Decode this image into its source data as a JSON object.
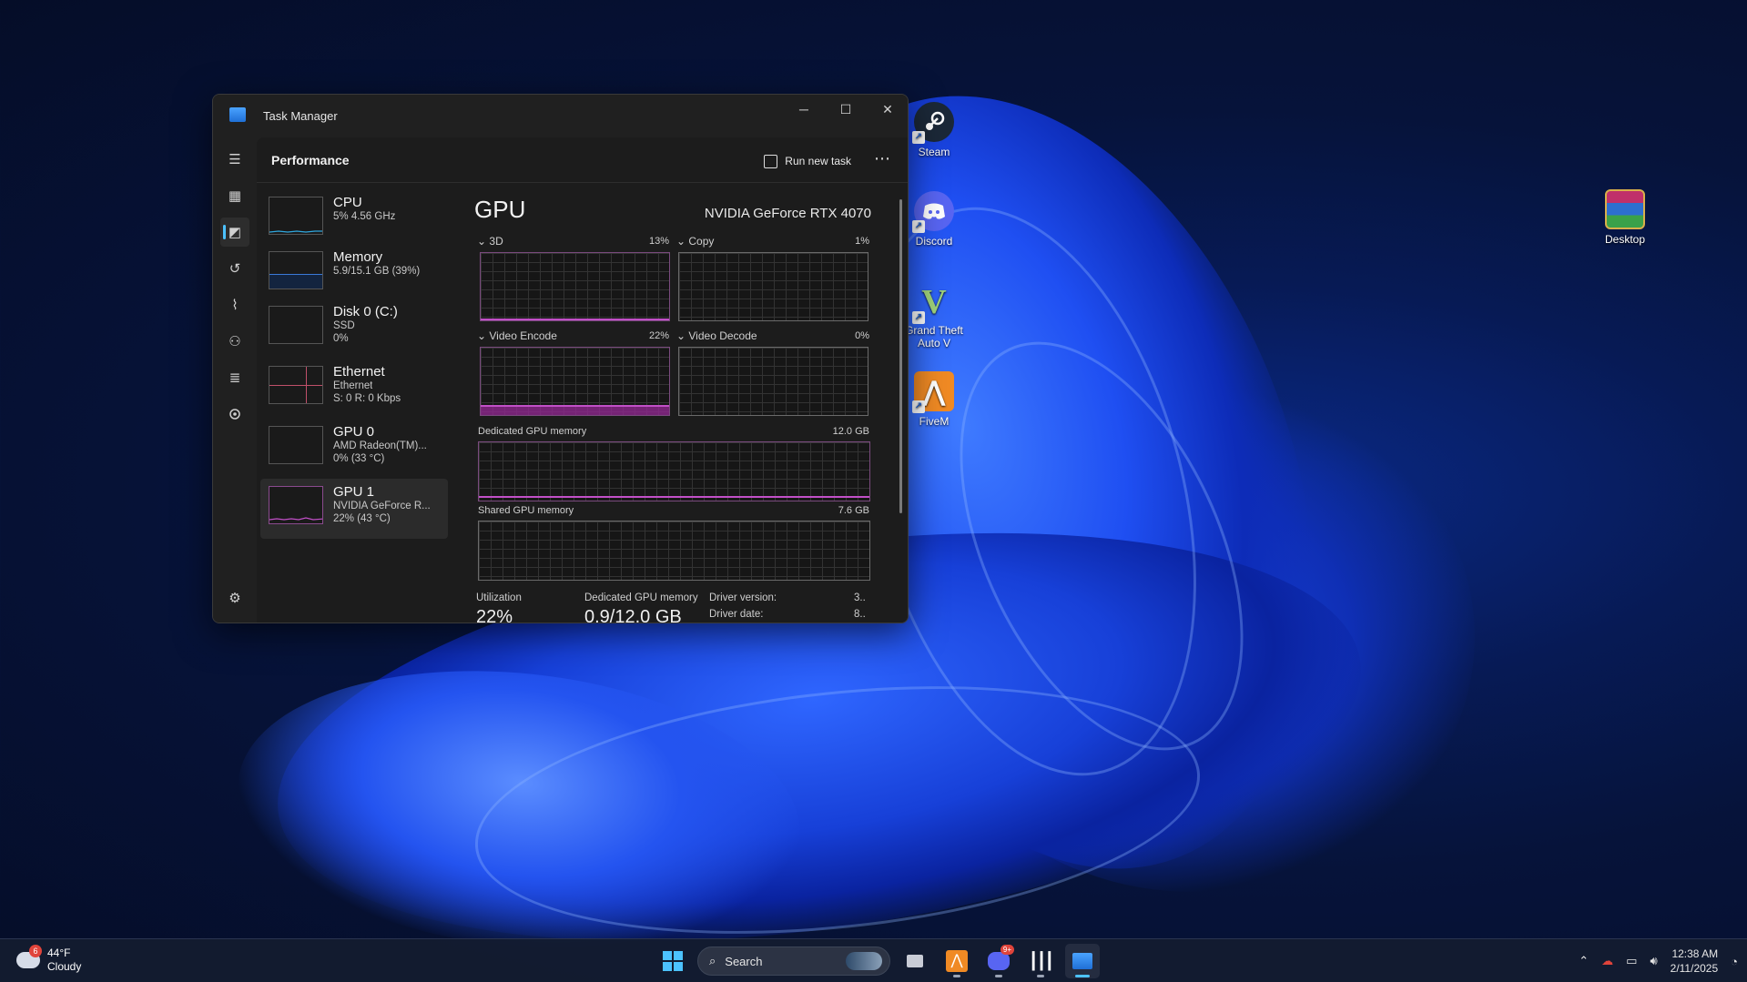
{
  "window": {
    "title": "Task Manager",
    "minimize_icon": "─",
    "maximize_icon": "☐",
    "close_icon": "✕"
  },
  "sidebar_icons": [
    "☰",
    "▦",
    "◩",
    "↺",
    "⌇",
    "⚇",
    "≣",
    "⚙"
  ],
  "header": {
    "title": "Performance",
    "run_new_task": "Run new task",
    "more": "⋯"
  },
  "perf_list": [
    {
      "name": "CPU",
      "line1": "5% 4.56 GHz",
      "line2": ""
    },
    {
      "name": "Memory",
      "line1": "5.9/15.1 GB (39%)",
      "line2": ""
    },
    {
      "name": "Disk 0 (C:)",
      "line1": "SSD",
      "line2": "0%"
    },
    {
      "name": "Ethernet",
      "line1": "Ethernet",
      "line2": "S: 0 R: 0 Kbps"
    },
    {
      "name": "GPU 0",
      "line1": "AMD Radeon(TM)...",
      "line2": "0% (33 °C)"
    },
    {
      "name": "GPU 1",
      "line1": "NVIDIA GeForce R...",
      "line2": "22% (43 °C)"
    }
  ],
  "gpu": {
    "title": "GPU",
    "model": "NVIDIA GeForce RTX 4070",
    "engines": [
      {
        "label": "3D",
        "percent": "13%",
        "value": 0.03
      },
      {
        "label": "Copy",
        "percent": "1%",
        "value": 0.0
      },
      {
        "label": "Video Encode",
        "percent": "22%",
        "value": 0.15
      },
      {
        "label": "Video Decode",
        "percent": "0%",
        "value": 0.0
      }
    ],
    "dedicated_label": "Dedicated GPU memory",
    "dedicated_max": "12.0 GB",
    "shared_label": "Shared GPU memory",
    "shared_max": "7.6 GB",
    "stats": {
      "utilization_label": "Utilization",
      "utilization_value": "22%",
      "dedicated_label": "Dedicated GPU memory",
      "dedicated_value": "0.9/12.0 GB",
      "driver_version_label": "Driver version:",
      "driver_version_value": "3..",
      "driver_date_label": "Driver date:",
      "driver_date_value": "8.."
    }
  },
  "desktop_icons": [
    {
      "label": "Steam",
      "color": "#1b2838"
    },
    {
      "label": "Discord",
      "color": "#5865f2"
    },
    {
      "label": "Grand Theft Auto V",
      "color": "#3a3a3a"
    },
    {
      "label": "FiveM",
      "color": "#f08a24"
    },
    {
      "label": "Desktop",
      "color": "#7a2a6a"
    }
  ],
  "taskbar": {
    "weather_temp": "44°F",
    "weather_desc": "Cloudy",
    "weather_badge": "6",
    "search_placeholder": "Search",
    "time": "12:38 AM",
    "date": "2/11/2025",
    "discord_badge": "9+"
  }
}
